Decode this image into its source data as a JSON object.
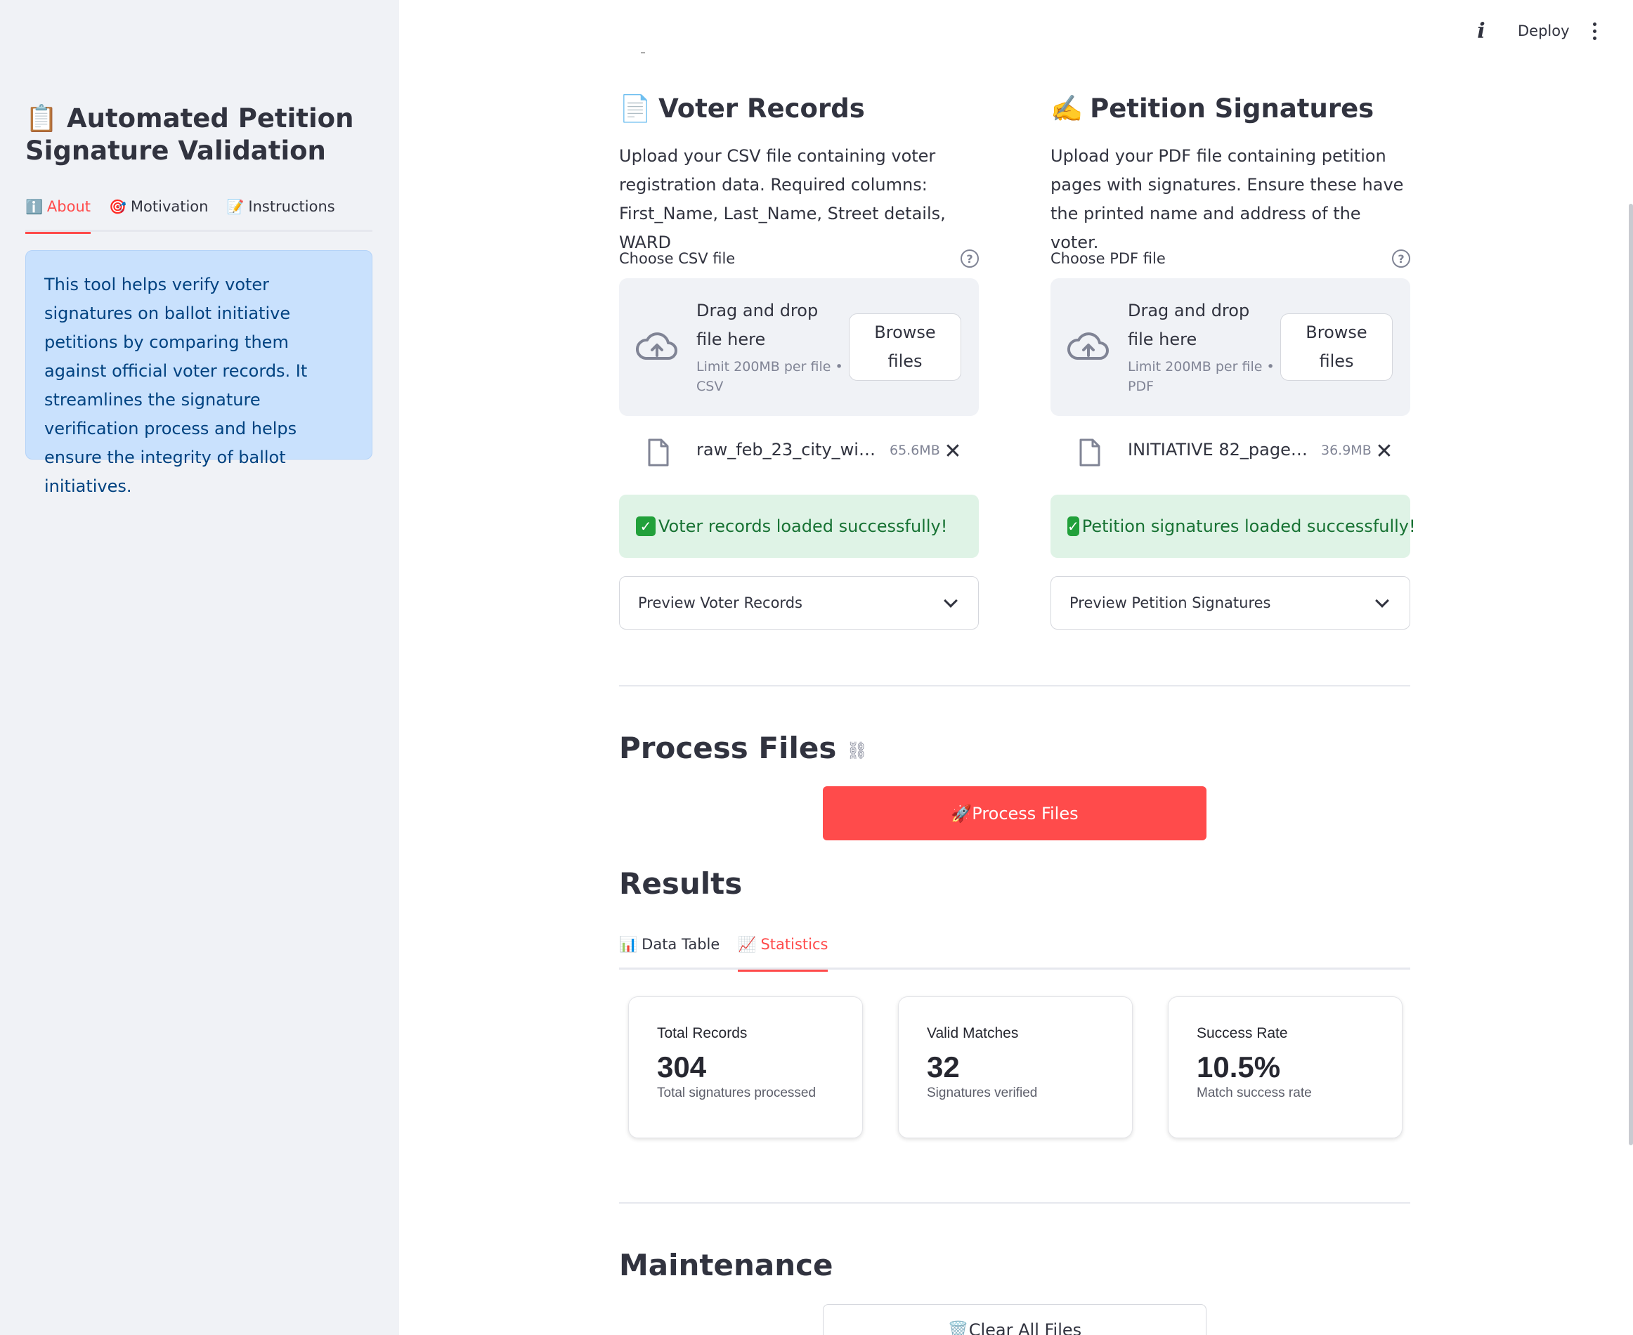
{
  "sidebar": {
    "title_icon": "📋",
    "title": "Automated Petition Signature Validation",
    "tabs": [
      {
        "icon": "ℹ️",
        "label": "About",
        "active": true
      },
      {
        "icon": "🎯",
        "label": "Motivation",
        "active": false
      },
      {
        "icon": "📝",
        "label": "Instructions",
        "active": false
      }
    ],
    "info_text": "This tool helps verify voter signatures on ballot initiative petitions by comparing them against official voter records. It streamlines the signature verification process and helps ensure the integrity of ballot initiatives."
  },
  "header": {
    "info_icon": "i",
    "deploy_label": "Deploy"
  },
  "voter": {
    "icon": "📄",
    "title": "Voter Records",
    "description": "Upload your CSV file containing voter registration data. Required columns: First_Name, Last_Name, Street details, WARD",
    "uploader_label": "Choose CSV file",
    "drop_text": "Drag and drop file here",
    "limit_text": "Limit 200MB per file • CSV",
    "browse_label": "Browse files",
    "file_name": "raw_feb_23_city_wid…",
    "file_size": "65.6MB",
    "success_text": "Voter records loaded successfully!",
    "expander_label": "Preview Voter Records"
  },
  "petition": {
    "icon": "✍️",
    "title": "Petition Signatures",
    "description": "Upload your PDF file containing petition pages with signatures. Ensure these have the printed name and address of the voter.",
    "uploader_label": "Choose PDF file",
    "drop_text": "Drag and drop file here",
    "limit_text": "Limit 200MB per file • PDF",
    "browse_label": "Browse files",
    "file_name": "INITIATIVE 82_pages_…",
    "file_size": "36.9MB",
    "success_text": "Petition signatures loaded successfully!",
    "expander_label": "Preview Petition Signatures"
  },
  "process": {
    "heading": "Process Files",
    "button_icon": "🚀",
    "button_label": "Process Files"
  },
  "results": {
    "heading": "Results",
    "tabs": [
      {
        "icon": "📊",
        "label": "Data Table",
        "active": false
      },
      {
        "icon": "📈",
        "label": "Statistics",
        "active": true
      }
    ],
    "metrics": [
      {
        "label": "Total Records",
        "value": "304",
        "sub": "Total signatures processed"
      },
      {
        "label": "Valid Matches",
        "value": "32",
        "sub": "Signatures verified"
      },
      {
        "label": "Success Rate",
        "value": "10.5%",
        "sub": "Match success rate"
      }
    ]
  },
  "maintenance": {
    "heading": "Maintenance",
    "button_icon": "🗑️",
    "button_label": "Clear All Files"
  },
  "colors": {
    "accent": "#ff4b4b",
    "sidebar_bg": "#f0f2f6",
    "info_bg": "#c9e1fd",
    "success_bg": "#dff3e6",
    "success_text": "#177233"
  }
}
